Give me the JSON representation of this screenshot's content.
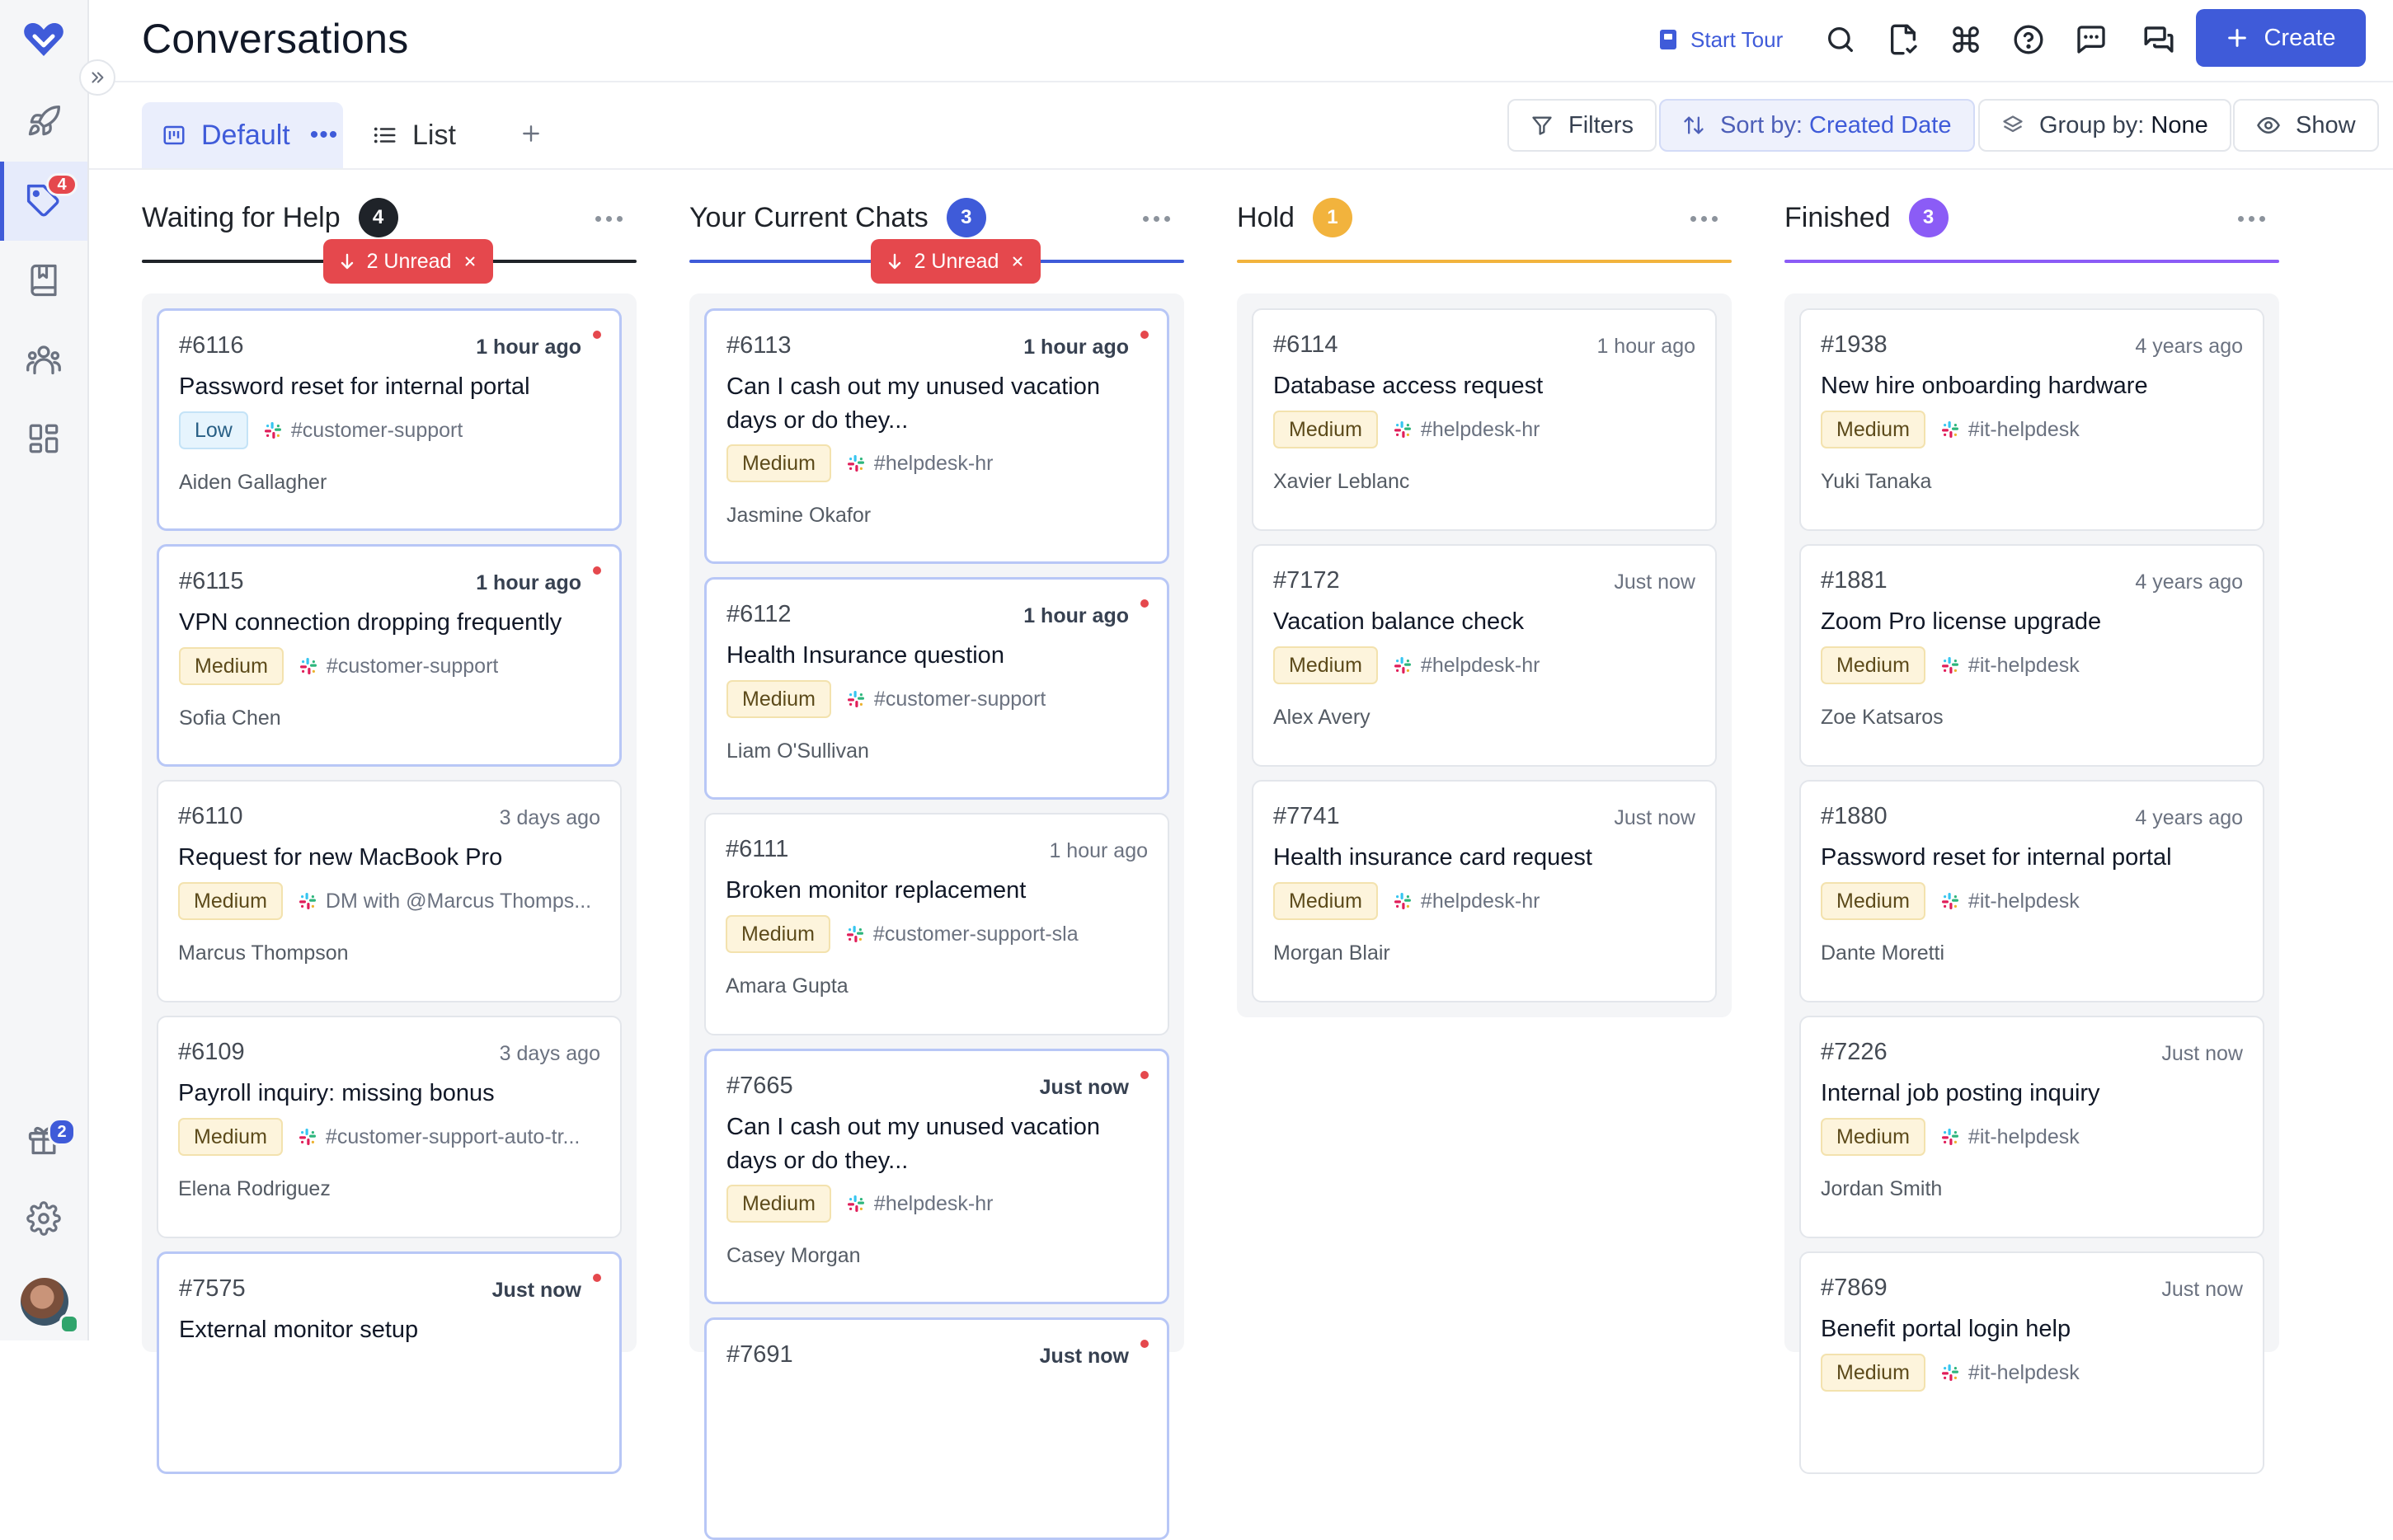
{
  "app": {
    "title": "Conversations",
    "accent_color": "#3f5bd9",
    "danger_color": "#e5484d"
  },
  "rail": {
    "items": [
      {
        "icon": "heart-logo-icon"
      },
      {
        "icon": "rocket-icon"
      },
      {
        "icon": "tag-icon",
        "badge": "4"
      },
      {
        "icon": "book-icon"
      },
      {
        "icon": "people-icon"
      },
      {
        "icon": "grid-icon"
      },
      {
        "icon": "gift-icon",
        "badge": "2"
      },
      {
        "icon": "gear-icon"
      }
    ]
  },
  "header": {
    "start_tour": "Start Tour",
    "create": "Create",
    "icons": [
      "search-icon",
      "document-check-icon",
      "command-icon",
      "help-icon",
      "message-icon",
      "chat-icon"
    ]
  },
  "views": {
    "tabs": [
      {
        "label": "Default",
        "active": true
      },
      {
        "label": "List",
        "active": false
      }
    ]
  },
  "toolbar": {
    "filters": "Filters",
    "sort_label": "Sort by:",
    "sort_value": "Created Date",
    "group_label": "Group by:",
    "group_value": "None",
    "show": "Show"
  },
  "columns": [
    {
      "title": "Waiting for Help",
      "count": "4",
      "color": "#1f2329",
      "unread": "2 Unread",
      "cards": [
        {
          "id": "#6116",
          "time": "1 hour ago",
          "unread": true,
          "title": "Password reset for internal portal",
          "priority": "Low",
          "channel": "#customer-support",
          "person": "Aiden Gallagher"
        },
        {
          "id": "#6115",
          "time": "1 hour ago",
          "unread": true,
          "title": "VPN connection dropping frequently",
          "priority": "Medium",
          "channel": "#customer-support",
          "person": "Sofia Chen"
        },
        {
          "id": "#6110",
          "time": "3 days ago",
          "unread": false,
          "title": "Request for new MacBook Pro",
          "priority": "Medium",
          "channel": "DM with @Marcus Thomps...",
          "person": "Marcus Thompson"
        },
        {
          "id": "#6109",
          "time": "3 days ago",
          "unread": false,
          "title": "Payroll inquiry: missing bonus",
          "priority": "Medium",
          "channel": "#customer-support-auto-tr...",
          "person": "Elena Rodriguez"
        },
        {
          "id": "#7575",
          "time": "Just now",
          "unread": true,
          "title": "External monitor setup",
          "priority": "",
          "channel": "",
          "person": ""
        }
      ]
    },
    {
      "title": "Your Current Chats",
      "count": "3",
      "color": "#3f5bd9",
      "unread": "2 Unread",
      "cards": [
        {
          "id": "#6113",
          "time": "1 hour ago",
          "unread": true,
          "title": "Can I cash out my unused vacation days or do they...",
          "priority": "Medium",
          "channel": "#helpdesk-hr",
          "person": "Jasmine Okafor"
        },
        {
          "id": "#6112",
          "time": "1 hour ago",
          "unread": true,
          "title": "Health Insurance question",
          "priority": "Medium",
          "channel": "#customer-support",
          "person": "Liam O'Sullivan"
        },
        {
          "id": "#6111",
          "time": "1 hour ago",
          "unread": false,
          "title": "Broken monitor replacement",
          "priority": "Medium",
          "channel": "#customer-support-sla",
          "person": "Amara Gupta"
        },
        {
          "id": "#7665",
          "time": "Just now",
          "unread": true,
          "title": "Can I cash out my unused vacation days or do they...",
          "priority": "Medium",
          "channel": "#helpdesk-hr",
          "person": "Casey Morgan"
        },
        {
          "id": "#7691",
          "time": "Just now",
          "unread": true,
          "title": "",
          "priority": "",
          "channel": "",
          "person": ""
        }
      ]
    },
    {
      "title": "Hold",
      "count": "1",
      "color": "#f2b33d",
      "unread": "",
      "cards": [
        {
          "id": "#6114",
          "time": "1 hour ago",
          "unread": false,
          "title": "Database access request",
          "priority": "Medium",
          "channel": "#helpdesk-hr",
          "person": "Xavier Leblanc"
        },
        {
          "id": "#7172",
          "time": "Just now",
          "unread": false,
          "title": "Vacation balance check",
          "priority": "Medium",
          "channel": "#helpdesk-hr",
          "person": "Alex Avery"
        },
        {
          "id": "#7741",
          "time": "Just now",
          "unread": false,
          "title": "Health insurance card request",
          "priority": "Medium",
          "channel": "#helpdesk-hr",
          "person": "Morgan Blair"
        }
      ]
    },
    {
      "title": "Finished",
      "count": "3",
      "color": "#8b5cf6",
      "unread": "",
      "cards": [
        {
          "id": "#1938",
          "time": "4 years ago",
          "unread": false,
          "title": "New hire onboarding hardware",
          "priority": "Medium",
          "channel": "#it-helpdesk",
          "person": "Yuki Tanaka"
        },
        {
          "id": "#1881",
          "time": "4 years ago",
          "unread": false,
          "title": "Zoom Pro license upgrade",
          "priority": "Medium",
          "channel": "#it-helpdesk",
          "person": "Zoe Katsaros"
        },
        {
          "id": "#1880",
          "time": "4 years ago",
          "unread": false,
          "title": "Password reset for internal portal",
          "priority": "Medium",
          "channel": "#it-helpdesk",
          "person": "Dante Moretti"
        },
        {
          "id": "#7226",
          "time": "Just now",
          "unread": false,
          "title": "Internal job posting inquiry",
          "priority": "Medium",
          "channel": "#it-helpdesk",
          "person": "Jordan Smith"
        },
        {
          "id": "#7869",
          "time": "Just now",
          "unread": false,
          "title": "Benefit portal login help",
          "priority": "Medium",
          "channel": "#it-helpdesk",
          "person": ""
        }
      ]
    }
  ]
}
